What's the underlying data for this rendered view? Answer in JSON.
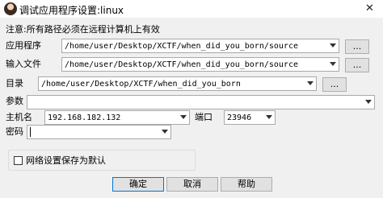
{
  "window": {
    "title": "调试应用程序设置:linux",
    "close_glyph": "✕"
  },
  "note": "注意:所有路径必须在远程计算机上有效",
  "fields": {
    "app": {
      "label": "应用程序",
      "value": "/home/user/Desktop/XCTF/when_did_you_born/source",
      "browse": "..."
    },
    "input": {
      "label": "输入文件",
      "value": "/home/user/Desktop/XCTF/when_did_you_born/source",
      "browse": "..."
    },
    "dir": {
      "label": "目录",
      "value": "/home/user/Desktop/XCTF/when_did_you_born",
      "browse": "..."
    },
    "params": {
      "label": "参数",
      "value": ""
    },
    "host": {
      "label": "主机名",
      "value": "192.168.182.132"
    },
    "port": {
      "label": "端口",
      "value": "23946"
    },
    "password": {
      "label": "密码",
      "value": ""
    }
  },
  "save_default": {
    "label": "网络设置保存为默认",
    "checked": false
  },
  "buttons": {
    "ok": "确定",
    "cancel": "取消",
    "help": "帮助"
  }
}
